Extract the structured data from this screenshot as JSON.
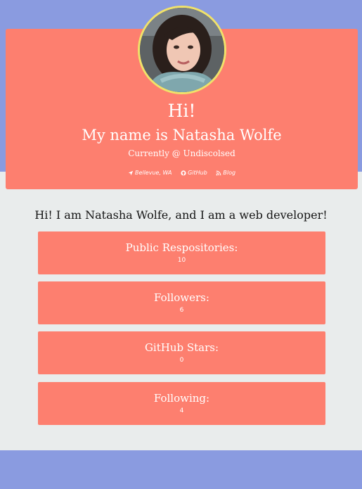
{
  "profile": {
    "greeting": "Hi!",
    "name_line": "My name is Natasha Wolfe",
    "company_line": "Currently @ Undiscolsed",
    "links": [
      {
        "icon": "location-arrow-icon",
        "label": "Bellevue, WA"
      },
      {
        "icon": "github-icon",
        "label": "GitHub"
      },
      {
        "icon": "rss-icon",
        "label": "Blog"
      }
    ]
  },
  "intro": "Hi! I am Natasha Wolfe, and I am a web developer!",
  "stats": [
    {
      "label": "Public Respositories:",
      "value": "10"
    },
    {
      "label": "Followers:",
      "value": "6"
    },
    {
      "label": "GitHub Stars:",
      "value": "0"
    },
    {
      "label": "Following:",
      "value": "4"
    }
  ],
  "colors": {
    "page_band": "#8a9be0",
    "content_bg": "#e9ecec",
    "card": "#fd7f6f",
    "avatar_border": "#f1e26a"
  }
}
